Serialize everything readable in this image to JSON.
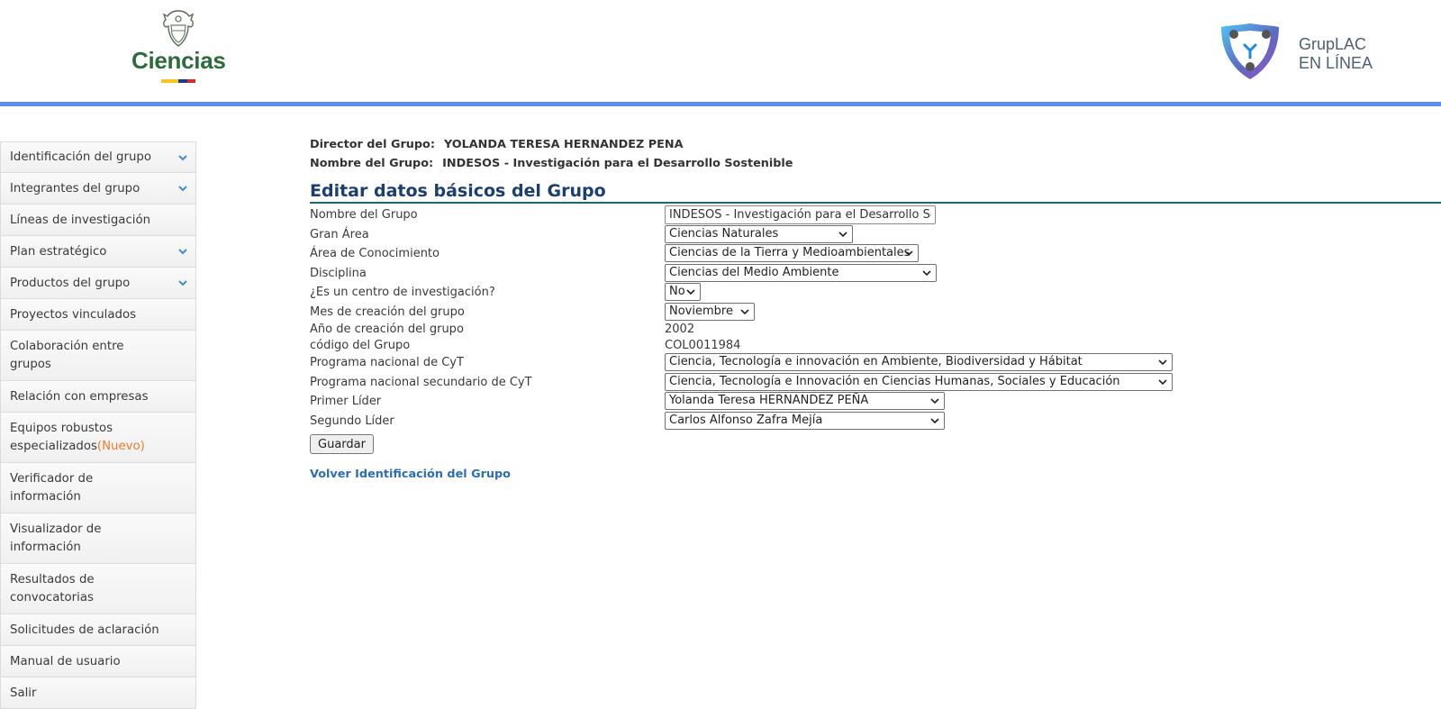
{
  "header": {
    "ministry_name": "Ciencias",
    "app_name_line1": "GrupLAC",
    "app_name_line2": "EN LÍNEA",
    "colors": {
      "ministry_green": "#2e6b3c",
      "header_rule": "#5b8ee6"
    }
  },
  "sidebar": {
    "items": [
      {
        "label": "Identificación del grupo",
        "expandable": true
      },
      {
        "label": "Integrantes del grupo",
        "expandable": true
      },
      {
        "label": "Líneas de investigación",
        "expandable": false
      },
      {
        "label": "Plan estratégico",
        "expandable": true
      },
      {
        "label": "Productos del grupo",
        "expandable": true
      },
      {
        "label": "Proyectos vinculados",
        "expandable": false
      },
      {
        "label": "Colaboración entre grupos",
        "expandable": false
      },
      {
        "label": "Relación con empresas",
        "expandable": false
      },
      {
        "label": "Equipos robustos especializados",
        "badge": "(Nuevo)",
        "expandable": false
      },
      {
        "label": "Verificador de información",
        "expandable": false
      },
      {
        "label": "Visualizador de información",
        "expandable": false
      },
      {
        "label": "Resultados de convocatorias",
        "expandable": false
      },
      {
        "label": "Solicitudes de aclaración",
        "expandable": false
      },
      {
        "label": "Manual de usuario",
        "expandable": false
      },
      {
        "label": "Salir",
        "expandable": false
      }
    ]
  },
  "group": {
    "director_label": "Director del Grupo:",
    "director_value": "YOLANDA TERESA HERNANDEZ PENA",
    "name_label": "Nombre del Grupo:",
    "name_value": "INDESOS - Investigación para el Desarrollo Sostenible"
  },
  "form": {
    "title": "Editar datos básicos del Grupo",
    "fields": {
      "nombre": {
        "label": "Nombre del Grupo",
        "value": "INDESOS - Investigación para el Desarrollo Soste"
      },
      "gran_area": {
        "label": "Gran Área",
        "value": "Ciencias Naturales"
      },
      "area": {
        "label": "Área de Conocimiento",
        "value": "Ciencias de la Tierra y Medioambientales"
      },
      "disciplina": {
        "label": "Disciplina",
        "value": "Ciencias del Medio Ambiente"
      },
      "centro": {
        "label": "¿Es un centro de investigación?",
        "value": "No"
      },
      "mes": {
        "label": "Mes de creación del grupo",
        "value": "Noviembre"
      },
      "anio": {
        "label": "Año de creación del grupo",
        "value": "2002"
      },
      "codigo": {
        "label": "código del Grupo",
        "value": "COL0011984"
      },
      "programa": {
        "label": "Programa nacional de CyT",
        "value": "Ciencia, Tecnología e innovación en Ambiente, Biodiversidad y Hábitat"
      },
      "programa2": {
        "label": "Programa nacional secundario de CyT",
        "value": "Ciencia, Tecnología e Innovación en Ciencias Humanas, Sociales y Educación"
      },
      "lider1": {
        "label": "Primer Líder",
        "value": "Yolanda Teresa HERNANDEZ PEÑA"
      },
      "lider2": {
        "label": "Segundo Líder",
        "value": "Carlos Alfonso Zafra Mejía"
      }
    },
    "save_label": "Guardar",
    "back_link": "Volver Identificación del Grupo"
  }
}
